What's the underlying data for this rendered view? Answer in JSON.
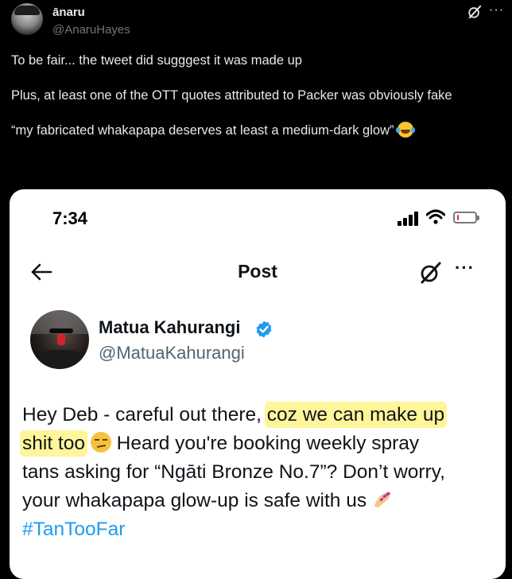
{
  "tweet": {
    "author_name": "ānaru",
    "author_handle": "@AnaruHayes",
    "avatar_icon": "avatar-photo",
    "grok_icon": "grok-slash-icon",
    "more_label": "···",
    "body_lines": [
      "To be fair... the tweet did sugggest it was made up",
      "Plus, at least one of the OTT quotes attributed to Packer was obviously fake",
      "“my fabricated whakapapa deserves at least a medium-dark glow”"
    ],
    "emoji": "face-with-tears-of-joy"
  },
  "embedded_screenshot": {
    "status_bar": {
      "time": "7:34",
      "battery_level": 0.1,
      "battery_color": "#e0245e"
    },
    "nav": {
      "title": "Post",
      "back_icon": "back-arrow-icon",
      "grok_icon": "grok-slash-icon",
      "more_label": "···"
    },
    "post": {
      "author_name": "Matua Kahurangi",
      "author_handle": "@MatuaKahurangi",
      "verified": true,
      "verified_color": "#1d9bf0",
      "text": {
        "l1_plain": "Hey Deb - careful out there, ",
        "l1_highlight": "coz we can make up",
        "l2_highlight": "shit too",
        "l2_rest": " Heard you're booking weekly spray",
        "l3": "tans asking for “Ngāti Bronze No.7”? Don’t worry,",
        "l4": "your whakapapa glow-up is safe with us ",
        "hashtag": "#TanTooFar"
      },
      "emojis": [
        "smirking-face",
        "nail-polish"
      ],
      "highlight_color": "#fff59a",
      "hashtag_color": "#1d9bf0"
    }
  }
}
